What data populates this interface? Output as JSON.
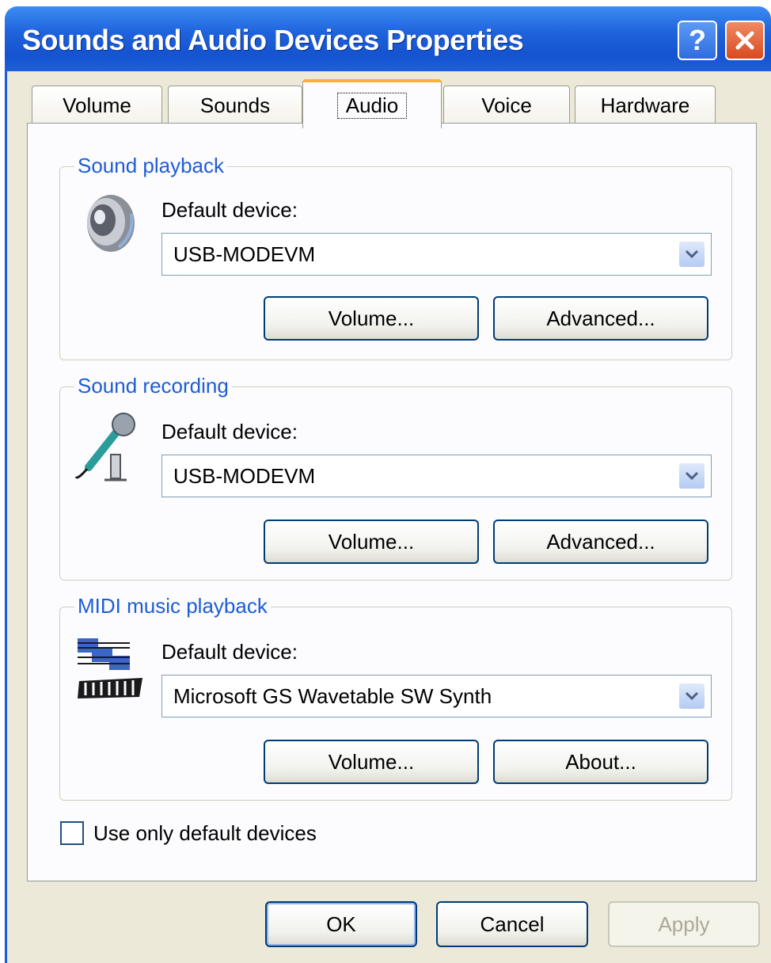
{
  "window": {
    "title": "Sounds and Audio Devices Properties",
    "help_symbol": "?",
    "accent_color": "#1553d0",
    "group_title_color": "#1e5dd6"
  },
  "tabs": [
    {
      "label": "Volume",
      "active": false
    },
    {
      "label": "Sounds",
      "active": false
    },
    {
      "label": "Audio",
      "active": true
    },
    {
      "label": "Voice",
      "active": false
    },
    {
      "label": "Hardware",
      "active": false
    }
  ],
  "sound_playback": {
    "title": "Sound playback",
    "label": "Default device:",
    "selected": "USB-MODEVM",
    "volume_button": "Volume...",
    "advanced_button": "Advanced...",
    "icon": "speaker-icon"
  },
  "sound_recording": {
    "title": "Sound recording",
    "label": "Default device:",
    "selected": "USB-MODEVM",
    "volume_button": "Volume...",
    "advanced_button": "Advanced...",
    "icon": "microphone-icon"
  },
  "midi_playback": {
    "title": "MIDI music playback",
    "label": "Default device:",
    "selected": "Microsoft GS Wavetable SW Synth",
    "volume_button": "Volume...",
    "about_button": "About...",
    "icon": "midi-keyboard-icon"
  },
  "use_default_devices": {
    "label": "Use only default devices",
    "checked": false
  },
  "footer": {
    "ok": "OK",
    "cancel": "Cancel",
    "apply": "Apply",
    "apply_enabled": false
  }
}
